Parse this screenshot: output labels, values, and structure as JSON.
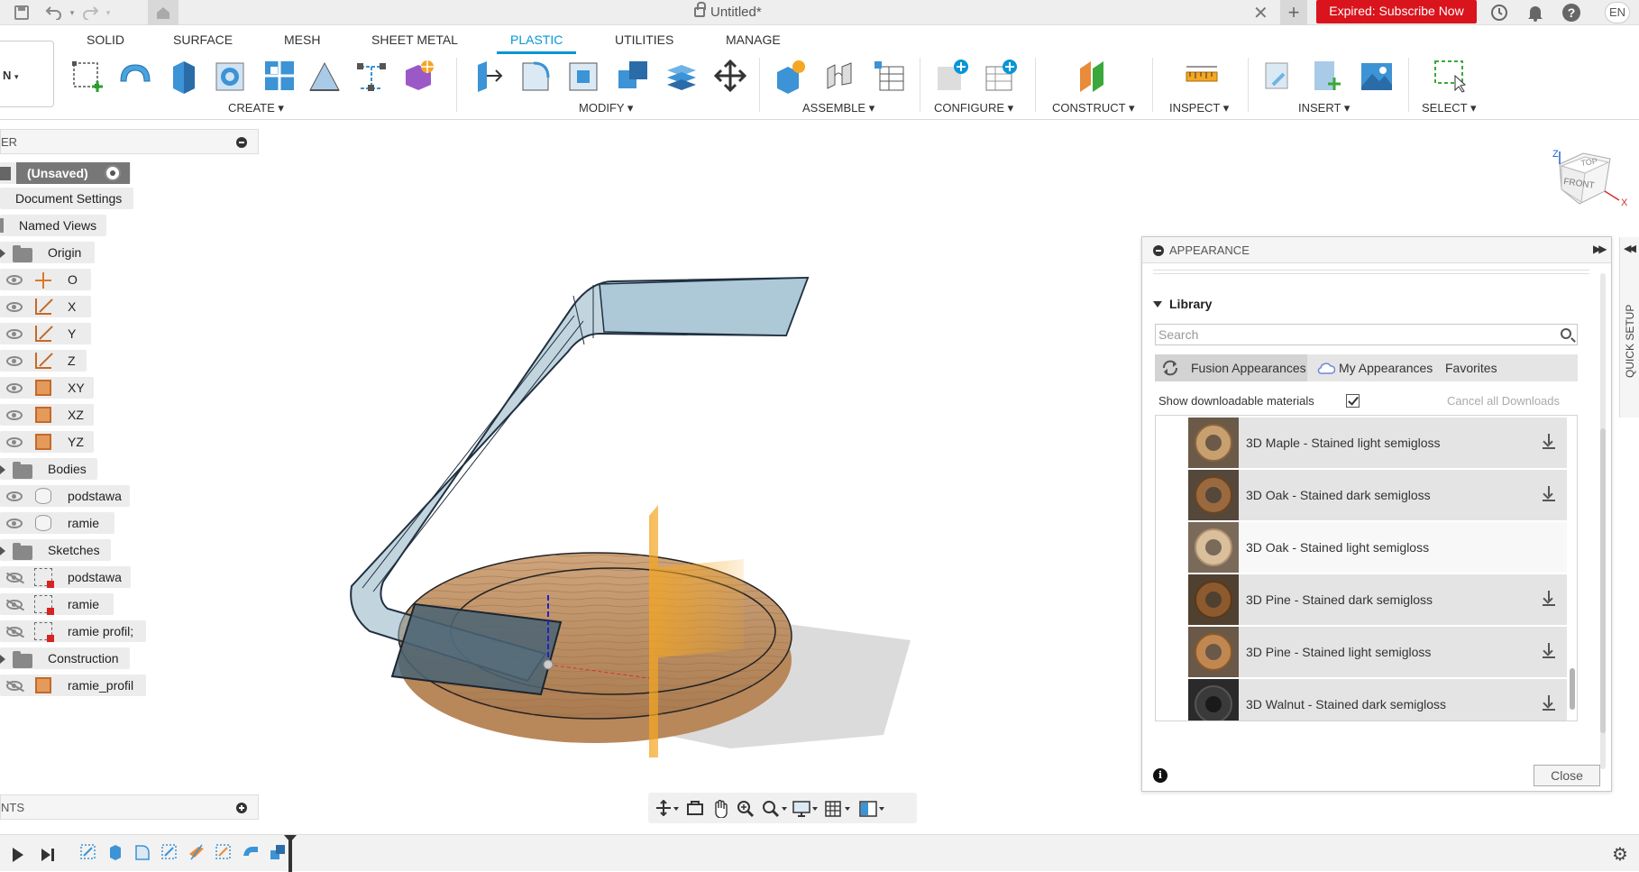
{
  "titlebar": {
    "document_title": "Untitled*",
    "expired_label": "Expired: Subscribe Now",
    "language": "EN"
  },
  "ribbon": {
    "workspace_label": "N",
    "tabs": [
      "SOLID",
      "SURFACE",
      "MESH",
      "SHEET METAL",
      "PLASTIC",
      "UTILITIES",
      "MANAGE"
    ],
    "active_tab": "PLASTIC",
    "groups": [
      "CREATE ▾",
      "MODIFY ▾",
      "ASSEMBLE ▾",
      "CONFIGURE ▾",
      "CONSTRUCT ▾",
      "INSPECT ▾",
      "INSERT ▾",
      "SELECT ▾"
    ]
  },
  "browser": {
    "header_title": "ER",
    "rows": [
      {
        "label": "(Unsaved)"
      },
      {
        "label": "Document Settings"
      },
      {
        "label": "Named Views"
      },
      {
        "label": "Origin"
      },
      {
        "label": "O"
      },
      {
        "label": "X"
      },
      {
        "label": "Y"
      },
      {
        "label": "Z"
      },
      {
        "label": "XY"
      },
      {
        "label": "XZ"
      },
      {
        "label": "YZ"
      },
      {
        "label": "Bodies"
      },
      {
        "label": "podstawa"
      },
      {
        "label": "ramie"
      },
      {
        "label": "Sketches"
      },
      {
        "label": "podstawa"
      },
      {
        "label": "ramie"
      },
      {
        "label": "ramie profil;"
      },
      {
        "label": "Construction"
      },
      {
        "label": "ramie_profil"
      }
    ]
  },
  "comments": {
    "header_title": "NTS"
  },
  "viewcube": {
    "top": "TOP",
    "front": "FRONT",
    "z": "Z",
    "x": "X"
  },
  "appearance": {
    "title": "APPEARANCE",
    "library_label": "Library",
    "search_placeholder": "Search",
    "tabs": [
      "Fusion Appearances",
      "My Appearances",
      "Favorites"
    ],
    "show_downloadable_label": "Show downloadable materials",
    "show_downloadable_checked": true,
    "cancel_downloads_label": "Cancel all Downloads",
    "materials": [
      {
        "name": "3D Maple - Stained light semigloss",
        "downloadable": true,
        "swatch": "#c8a070"
      },
      {
        "name": "3D Oak - Stained dark semigloss",
        "downloadable": true,
        "swatch": "#9a6a3e"
      },
      {
        "name": "3D Oak - Stained light semigloss",
        "downloadable": false,
        "swatch": "#d9bf9c"
      },
      {
        "name": "3D Pine - Stained dark semigloss",
        "downloadable": true,
        "swatch": "#8c5a2e"
      },
      {
        "name": "3D Pine - Stained light semigloss",
        "downloadable": true,
        "swatch": "#c08850"
      },
      {
        "name": "3D Walnut - Stained dark semigloss",
        "downloadable": true,
        "swatch": "#3a3a3a"
      }
    ],
    "close_label": "Close"
  },
  "quick_setup": {
    "label": "QUICK SETUP"
  }
}
